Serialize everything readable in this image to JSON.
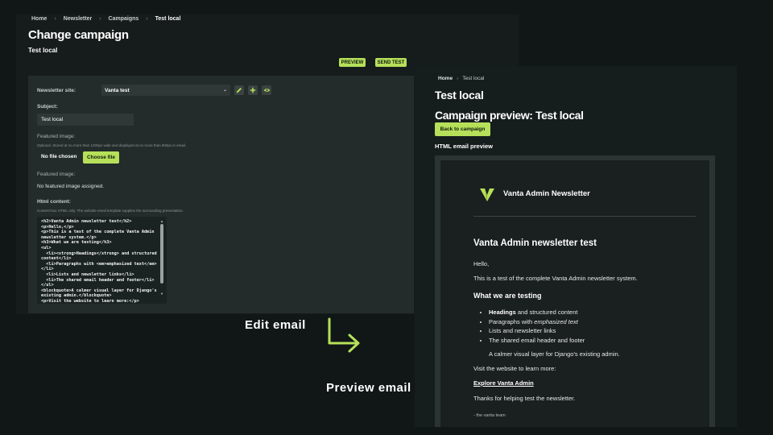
{
  "edit": {
    "breadcrumb": [
      "Home",
      "Newsletter",
      "Campaigns",
      "Test local"
    ],
    "title": "Change campaign",
    "object_name": "Test local",
    "preview_label": "PREVIEW",
    "send_test_label": "SEND TEST",
    "fields": {
      "newsletter_site_label": "Newsletter site:",
      "newsletter_site_value": "Vanta test",
      "subject_label": "Subject:",
      "subject_value": "Test local",
      "featured_image_label": "Featured image:",
      "featured_image_help": "Optional. Stored at no more than 1200px wide and displayed at no more than 800px in email.",
      "file_status": "No file chosen",
      "choose_file_label": "Choose file",
      "featured_image_label2": "Featured image:",
      "no_image_text": "No featured image assigned.",
      "html_content_label": "Html content:",
      "html_content_help": "Content-box HTML only. The website email template supplies the surrounding presentation.",
      "html_content_value": "<h2>Vanta Admin newsletter test</h2>\n<p>Hello,</p>\n<p>This is a test of the complete Vanta Admin newsletter system.</p>\n<h3>What we are testing</h3>\n<ul>\n  <li><strong>Headings</strong> and structured content</li>\n  <li>Paragraphs with <em>emphasized text</em></li>\n  <li>Lists and newsletter links</li>\n  <li>The shared email header and footer</li>\n</ul>\n<blockquote>A calmer visual layer for Django's existing admin.</blockquote>\n<p>Visit the website to learn more:</p>\n<p><a href=\"https://vantaadmin.com/\">Explore Vanta Admin</a></p>"
    }
  },
  "annotations": {
    "edit": "Edit email",
    "preview": "Preview email"
  },
  "preview": {
    "breadcrumb_home": "Home",
    "breadcrumb_current": "Test local",
    "title": "Test local",
    "heading": "Campaign preview: Test local",
    "back_label": "Back to campaign",
    "section_label": "HTML email preview",
    "email": {
      "brand": "Vanta Admin Newsletter",
      "h2": "Vanta Admin newsletter test",
      "greeting": "Hello,",
      "intro": "This is a test of the complete Vanta Admin newsletter system.",
      "h3": "What we are testing",
      "list": [
        {
          "bold": "Headings",
          "rest": " and structured content"
        },
        {
          "pre": "Paragraphs with ",
          "em": "emphasized text"
        },
        {
          "text": "Lists and newsletter links"
        },
        {
          "text": "The shared email header and footer"
        }
      ],
      "quote": "A calmer visual layer for Django's existing admin.",
      "visit": "Visit the website to learn more:",
      "link": "Explore Vanta Admin",
      "thanks": "Thanks for helping test the newsletter.",
      "signature": "- the vanta team"
    }
  },
  "colors": {
    "accent": "#b6e05a",
    "background": "#101716"
  }
}
